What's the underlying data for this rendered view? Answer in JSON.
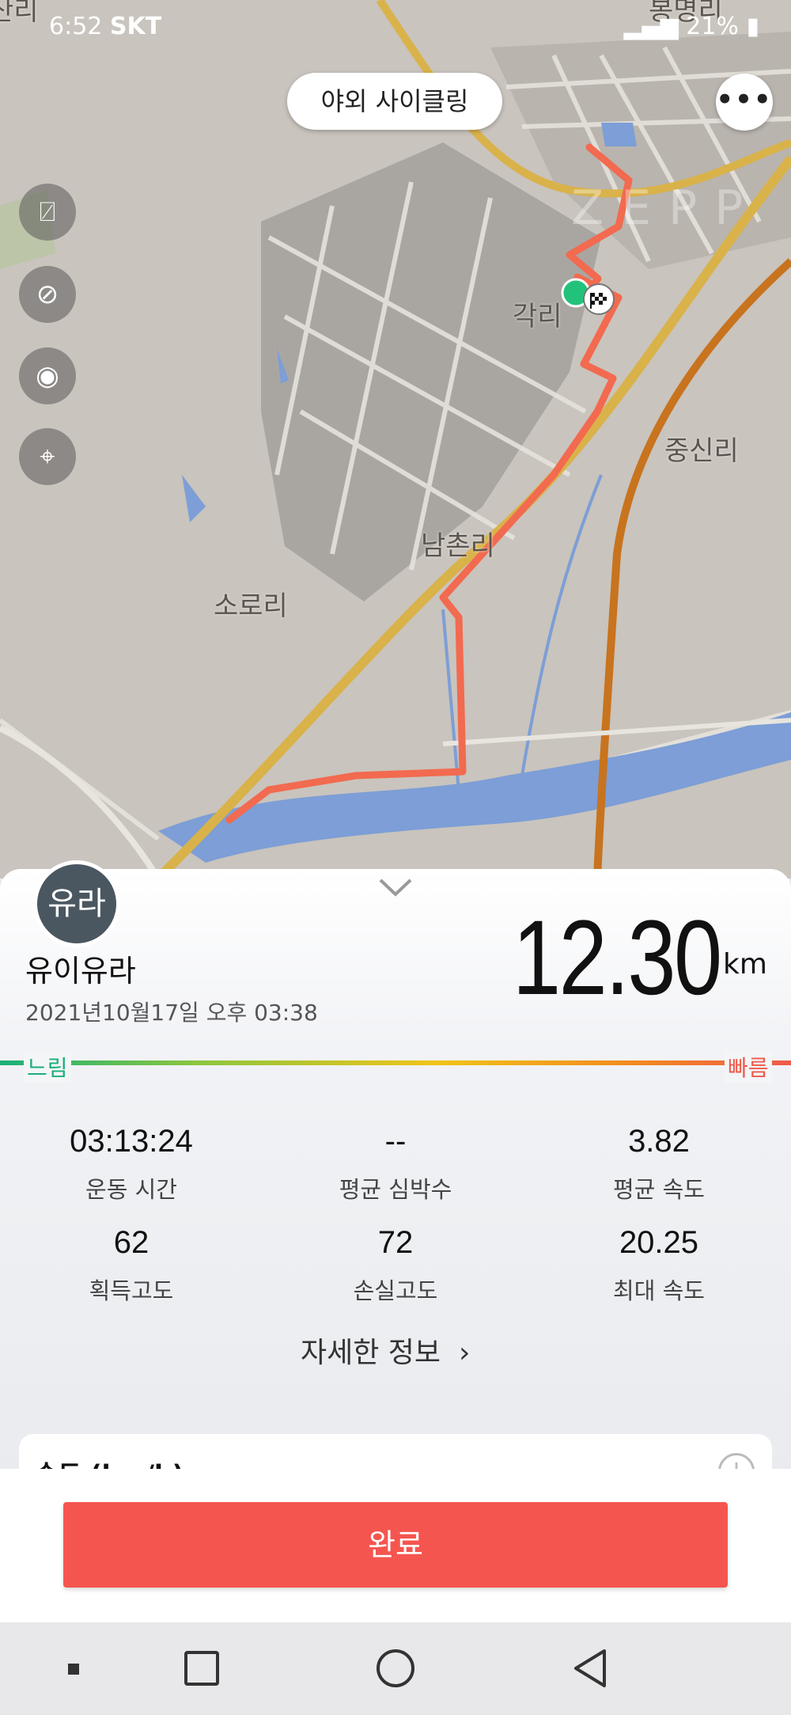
{
  "status_bar": {
    "time": "6:52",
    "carrier": "SKT",
    "battery": "21%"
  },
  "map": {
    "title": "야외 사이클링",
    "watermark": "ZEPP",
    "places": [
      "각리",
      "중신리",
      "남촌리",
      "소로리",
      "봉명리",
      "산리"
    ]
  },
  "user": {
    "avatar_text": "유라",
    "name": "유이유라",
    "datetime": "2021년10월17일 오후 03:38"
  },
  "distance": {
    "value": "12.30",
    "unit": "km"
  },
  "speed_scale": {
    "slow": "느림",
    "fast": "빠름"
  },
  "stats": [
    {
      "value": "03:13:24",
      "label": "운동 시간"
    },
    {
      "value": "--",
      "label": "평균 심박수"
    },
    {
      "value": "3.82",
      "label": "평균 속도"
    },
    {
      "value": "62",
      "label": "획득고도"
    },
    {
      "value": "72",
      "label": "손실고도"
    },
    {
      "value": "20.25",
      "label": "최대 속도"
    }
  ],
  "detail_link": "자세한 정보",
  "card": {
    "title": "속도 (km/h)"
  },
  "done_button": "완료",
  "colors": {
    "route": "#f26a4f",
    "accent": "#f5554f",
    "slow": "#1ab07a",
    "fast": "#ef5a4a"
  }
}
